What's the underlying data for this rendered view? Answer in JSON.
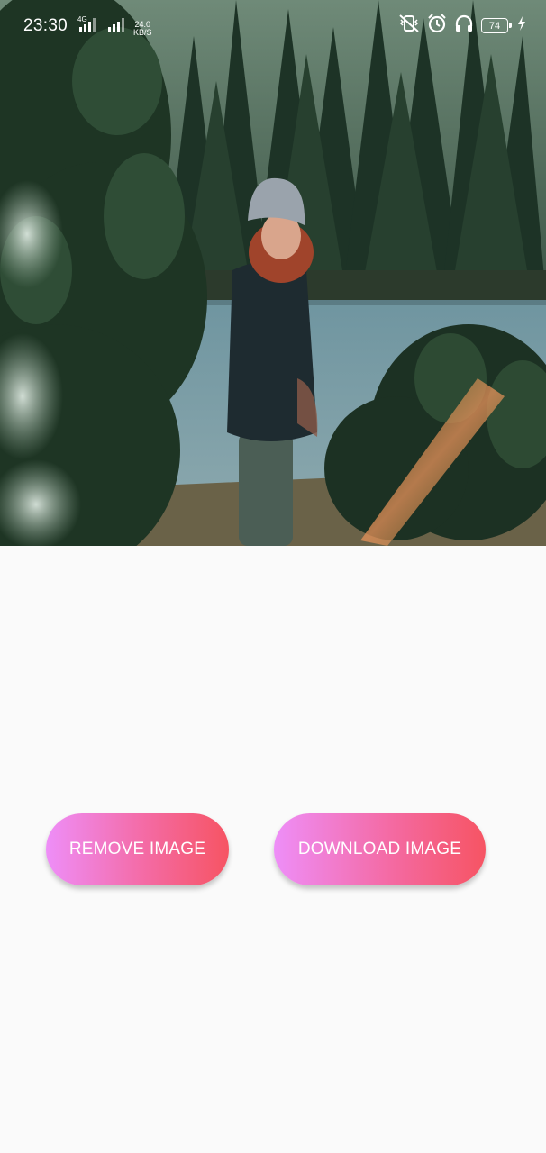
{
  "status_bar": {
    "time": "23:30",
    "net_speed_value": "24.0",
    "net_speed_unit": "KB/S",
    "battery_level": "74",
    "icons": [
      "sim-4g-signal-icon",
      "signal-icon",
      "vibrate-icon",
      "alarm-icon",
      "headphones-icon",
      "battery-icon",
      "charging-icon"
    ]
  },
  "photo": {
    "description_icon": "photo-image"
  },
  "buttons": {
    "remove_label": "REMOVE IMAGE",
    "download_label": "DOWNLOAD IMAGE"
  },
  "colors": {
    "background": "#fafafa",
    "button_gradient_start": "#ee8ef8",
    "button_gradient_end": "#f65463"
  }
}
